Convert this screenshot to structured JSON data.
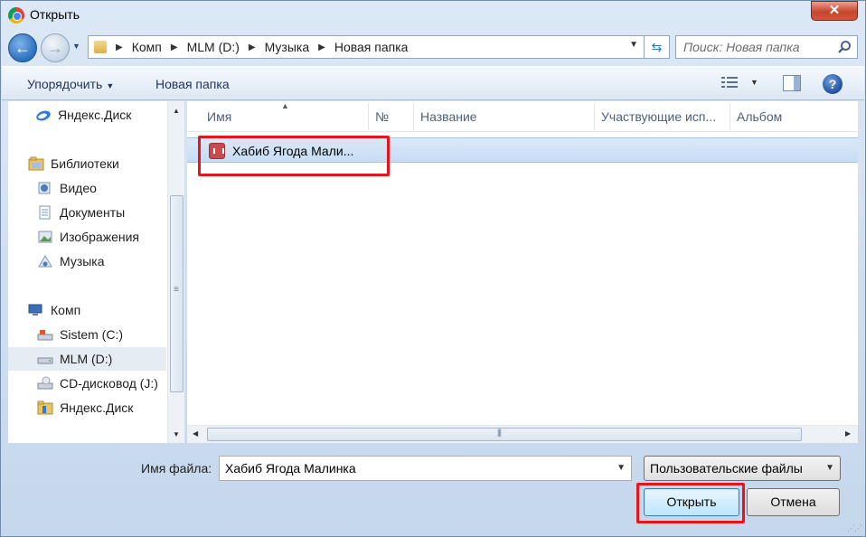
{
  "window": {
    "title": "Открыть",
    "close_label": "✕"
  },
  "address": {
    "crumbs": [
      "Комп",
      "MLM (D:)",
      "Музыка",
      "Новая папка"
    ]
  },
  "search": {
    "placeholder": "Поиск: Новая папка"
  },
  "toolbar": {
    "organize_label": "Упорядочить",
    "new_folder_label": "Новая папка",
    "help_label": "?"
  },
  "nav": {
    "items": [
      {
        "label": "Яндекс.Диск",
        "icon": "yandex-disk-icon"
      },
      {
        "label": "Библиотеки",
        "icon": "libraries-icon"
      },
      {
        "label": "Видео",
        "icon": "video-library-icon"
      },
      {
        "label": "Документы",
        "icon": "documents-library-icon"
      },
      {
        "label": "Изображения",
        "icon": "pictures-library-icon"
      },
      {
        "label": "Музыка",
        "icon": "music-library-icon"
      },
      {
        "label": "Комп",
        "icon": "computer-icon"
      },
      {
        "label": "Sistem (C:)",
        "icon": "system-drive-icon"
      },
      {
        "label": "MLM (D:)",
        "icon": "drive-icon",
        "selected": true
      },
      {
        "label": "CD-дисковод (J:)",
        "icon": "cd-drive-icon"
      },
      {
        "label": "Яндекс.Диск",
        "icon": "yandex-folder-icon"
      }
    ]
  },
  "columns": [
    "Имя",
    "№",
    "Название",
    "Участвующие исп...",
    "Альбом"
  ],
  "files": [
    {
      "name": "Хабиб Ягода Мали...",
      "icon": "audio-file-icon",
      "selected": true
    }
  ],
  "bottom": {
    "filename_label": "Имя файла:",
    "filename_value": "Хабиб Ягода Малинка",
    "filter_value": "Пользовательские файлы",
    "open_label": "Открыть",
    "cancel_label": "Отмена"
  },
  "colors": {
    "highlight": "#e8141a",
    "selection": "#c6dcf3",
    "accent": "#2a6fc0"
  }
}
